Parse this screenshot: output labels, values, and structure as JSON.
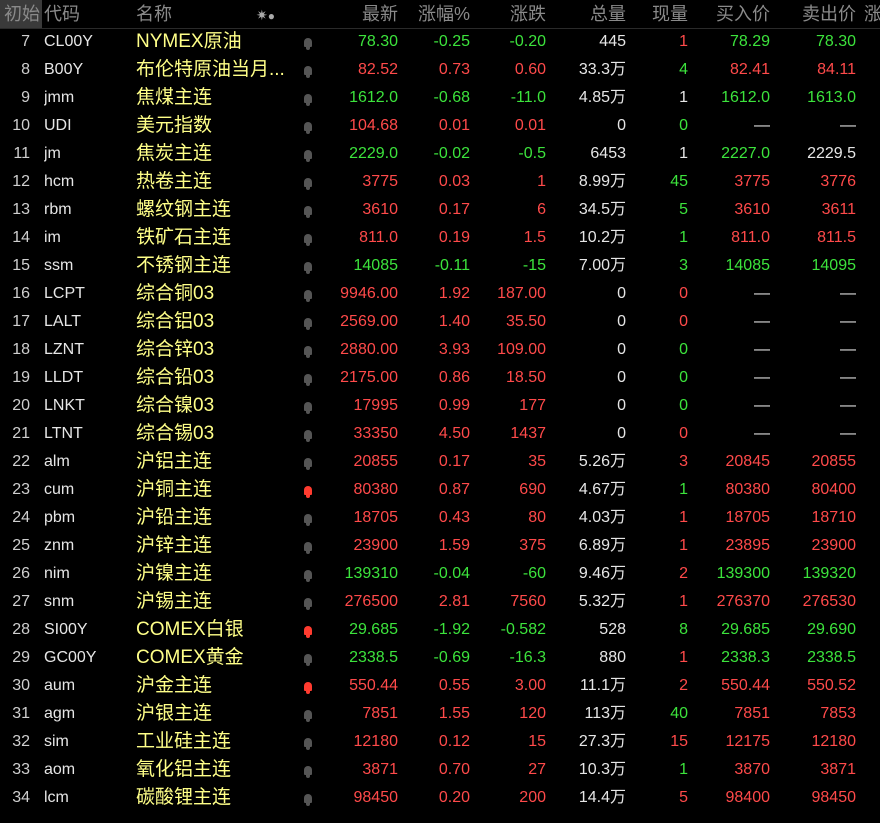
{
  "header": {
    "first": "初始",
    "code": "代码",
    "name": "名称",
    "settings_icon": "settings-icon",
    "last": "最新",
    "pct": "涨幅%",
    "chg": "涨跌",
    "vol": "总量",
    "cur": "现量",
    "bid": "买入价",
    "ask": "卖出价",
    "more": "涨"
  },
  "rows": [
    {
      "num": "7",
      "code": "CL00Y",
      "name": "NYMEX原油",
      "bell": false,
      "last": "78.30",
      "pct": "-0.25",
      "chg": "-0.20",
      "vol": "445",
      "cur": "1",
      "bid": "78.29",
      "ask": "78.30",
      "dir": "down",
      "cur_dir": "up",
      "bid_dir": "down",
      "ask_dir": "down"
    },
    {
      "num": "8",
      "code": "B00Y",
      "name": "布伦特原油当月...",
      "bell": false,
      "last": "82.52",
      "pct": "0.73",
      "chg": "0.60",
      "vol": "33.3万",
      "cur": "4",
      "bid": "82.41",
      "ask": "84.11",
      "dir": "up",
      "cur_dir": "down",
      "bid_dir": "up",
      "ask_dir": "up"
    },
    {
      "num": "9",
      "code": "jmm",
      "name": "焦煤主连",
      "bell": false,
      "last": "1612.0",
      "pct": "-0.68",
      "chg": "-11.0",
      "vol": "4.85万",
      "cur": "1",
      "bid": "1612.0",
      "ask": "1613.0",
      "dir": "down",
      "cur_dir": "flat",
      "bid_dir": "down",
      "ask_dir": "down"
    },
    {
      "num": "10",
      "code": "UDI",
      "name": "美元指数",
      "bell": false,
      "last": "104.68",
      "pct": "0.01",
      "chg": "0.01",
      "vol": "0",
      "cur": "0",
      "bid": "—",
      "ask": "—",
      "dir": "up",
      "cur_dir": "down",
      "bid_dir": "flat",
      "ask_dir": "flat"
    },
    {
      "num": "11",
      "code": "jm",
      "name": "焦炭主连",
      "bell": false,
      "last": "2229.0",
      "pct": "-0.02",
      "chg": "-0.5",
      "vol": "6453",
      "cur": "1",
      "bid": "2227.0",
      "ask": "2229.5",
      "dir": "down",
      "cur_dir": "flat",
      "bid_dir": "down",
      "ask_dir": "flat"
    },
    {
      "num": "12",
      "code": "hcm",
      "name": "热卷主连",
      "bell": false,
      "last": "3775",
      "pct": "0.03",
      "chg": "1",
      "vol": "8.99万",
      "cur": "45",
      "bid": "3775",
      "ask": "3776",
      "dir": "up",
      "cur_dir": "down",
      "bid_dir": "up",
      "ask_dir": "up"
    },
    {
      "num": "13",
      "code": "rbm",
      "name": "螺纹钢主连",
      "bell": false,
      "last": "3610",
      "pct": "0.17",
      "chg": "6",
      "vol": "34.5万",
      "cur": "5",
      "bid": "3610",
      "ask": "3611",
      "dir": "up",
      "cur_dir": "down",
      "bid_dir": "up",
      "ask_dir": "up"
    },
    {
      "num": "14",
      "code": "im",
      "name": "铁矿石主连",
      "bell": false,
      "last": "811.0",
      "pct": "0.19",
      "chg": "1.5",
      "vol": "10.2万",
      "cur": "1",
      "bid": "811.0",
      "ask": "811.5",
      "dir": "up",
      "cur_dir": "down",
      "bid_dir": "up",
      "ask_dir": "up"
    },
    {
      "num": "15",
      "code": "ssm",
      "name": "不锈钢主连",
      "bell": false,
      "last": "14085",
      "pct": "-0.11",
      "chg": "-15",
      "vol": "7.00万",
      "cur": "3",
      "bid": "14085",
      "ask": "14095",
      "dir": "down",
      "cur_dir": "down",
      "bid_dir": "down",
      "ask_dir": "down"
    },
    {
      "num": "16",
      "code": "LCPT",
      "name": "综合铜03",
      "bell": false,
      "last": "9946.00",
      "pct": "1.92",
      "chg": "187.00",
      "vol": "0",
      "cur": "0",
      "bid": "—",
      "ask": "—",
      "dir": "up",
      "cur_dir": "up",
      "bid_dir": "flat",
      "ask_dir": "flat"
    },
    {
      "num": "17",
      "code": "LALT",
      "name": "综合铝03",
      "bell": false,
      "last": "2569.00",
      "pct": "1.40",
      "chg": "35.50",
      "vol": "0",
      "cur": "0",
      "bid": "—",
      "ask": "—",
      "dir": "up",
      "cur_dir": "up",
      "bid_dir": "flat",
      "ask_dir": "flat"
    },
    {
      "num": "18",
      "code": "LZNT",
      "name": "综合锌03",
      "bell": false,
      "last": "2880.00",
      "pct": "3.93",
      "chg": "109.00",
      "vol": "0",
      "cur": "0",
      "bid": "—",
      "ask": "—",
      "dir": "up",
      "cur_dir": "down",
      "bid_dir": "flat",
      "ask_dir": "flat"
    },
    {
      "num": "19",
      "code": "LLDT",
      "name": "综合铅03",
      "bell": false,
      "last": "2175.00",
      "pct": "0.86",
      "chg": "18.50",
      "vol": "0",
      "cur": "0",
      "bid": "—",
      "ask": "—",
      "dir": "up",
      "cur_dir": "down",
      "bid_dir": "flat",
      "ask_dir": "flat"
    },
    {
      "num": "20",
      "code": "LNKT",
      "name": "综合镍03",
      "bell": false,
      "last": "17995",
      "pct": "0.99",
      "chg": "177",
      "vol": "0",
      "cur": "0",
      "bid": "—",
      "ask": "—",
      "dir": "up",
      "cur_dir": "down",
      "bid_dir": "flat",
      "ask_dir": "flat"
    },
    {
      "num": "21",
      "code": "LTNT",
      "name": "综合锡03",
      "bell": false,
      "last": "33350",
      "pct": "4.50",
      "chg": "1437",
      "vol": "0",
      "cur": "0",
      "bid": "—",
      "ask": "—",
      "dir": "up",
      "cur_dir": "up",
      "bid_dir": "flat",
      "ask_dir": "flat"
    },
    {
      "num": "22",
      "code": "alm",
      "name": "沪铝主连",
      "bell": false,
      "last": "20855",
      "pct": "0.17",
      "chg": "35",
      "vol": "5.26万",
      "cur": "3",
      "bid": "20845",
      "ask": "20855",
      "dir": "up",
      "cur_dir": "up",
      "bid_dir": "up",
      "ask_dir": "up"
    },
    {
      "num": "23",
      "code": "cum",
      "name": "沪铜主连",
      "bell": true,
      "last": "80380",
      "pct": "0.87",
      "chg": "690",
      "vol": "4.67万",
      "cur": "1",
      "bid": "80380",
      "ask": "80400",
      "dir": "up",
      "cur_dir": "down",
      "bid_dir": "up",
      "ask_dir": "up"
    },
    {
      "num": "24",
      "code": "pbm",
      "name": "沪铅主连",
      "bell": false,
      "last": "18705",
      "pct": "0.43",
      "chg": "80",
      "vol": "4.03万",
      "cur": "1",
      "bid": "18705",
      "ask": "18710",
      "dir": "up",
      "cur_dir": "up",
      "bid_dir": "up",
      "ask_dir": "up"
    },
    {
      "num": "25",
      "code": "znm",
      "name": "沪锌主连",
      "bell": false,
      "last": "23900",
      "pct": "1.59",
      "chg": "375",
      "vol": "6.89万",
      "cur": "1",
      "bid": "23895",
      "ask": "23900",
      "dir": "up",
      "cur_dir": "up",
      "bid_dir": "up",
      "ask_dir": "up"
    },
    {
      "num": "26",
      "code": "nim",
      "name": "沪镍主连",
      "bell": false,
      "last": "139310",
      "pct": "-0.04",
      "chg": "-60",
      "vol": "9.46万",
      "cur": "2",
      "bid": "139300",
      "ask": "139320",
      "dir": "down",
      "cur_dir": "up",
      "bid_dir": "down",
      "ask_dir": "down"
    },
    {
      "num": "27",
      "code": "snm",
      "name": "沪锡主连",
      "bell": false,
      "last": "276500",
      "pct": "2.81",
      "chg": "7560",
      "vol": "5.32万",
      "cur": "1",
      "bid": "276370",
      "ask": "276530",
      "dir": "up",
      "cur_dir": "up",
      "bid_dir": "up",
      "ask_dir": "up"
    },
    {
      "num": "28",
      "code": "SI00Y",
      "name": "COMEX白银",
      "bell": true,
      "last": "29.685",
      "pct": "-1.92",
      "chg": "-0.582",
      "vol": "528",
      "cur": "8",
      "bid": "29.685",
      "ask": "29.690",
      "dir": "down",
      "cur_dir": "down",
      "bid_dir": "down",
      "ask_dir": "down"
    },
    {
      "num": "29",
      "code": "GC00Y",
      "name": "COMEX黄金",
      "bell": false,
      "last": "2338.5",
      "pct": "-0.69",
      "chg": "-16.3",
      "vol": "880",
      "cur": "1",
      "bid": "2338.3",
      "ask": "2338.5",
      "dir": "down",
      "cur_dir": "up",
      "bid_dir": "down",
      "ask_dir": "down"
    },
    {
      "num": "30",
      "code": "aum",
      "name": "沪金主连",
      "bell": true,
      "last": "550.44",
      "pct": "0.55",
      "chg": "3.00",
      "vol": "11.1万",
      "cur": "2",
      "bid": "550.44",
      "ask": "550.52",
      "dir": "up",
      "cur_dir": "up",
      "bid_dir": "up",
      "ask_dir": "up"
    },
    {
      "num": "31",
      "code": "agm",
      "name": "沪银主连",
      "bell": false,
      "last": "7851",
      "pct": "1.55",
      "chg": "120",
      "vol": "113万",
      "cur": "40",
      "bid": "7851",
      "ask": "7853",
      "dir": "up",
      "cur_dir": "down",
      "bid_dir": "up",
      "ask_dir": "up"
    },
    {
      "num": "32",
      "code": "sim",
      "name": "工业硅主连",
      "bell": false,
      "last": "12180",
      "pct": "0.12",
      "chg": "15",
      "vol": "27.3万",
      "cur": "15",
      "bid": "12175",
      "ask": "12180",
      "dir": "up",
      "cur_dir": "up",
      "bid_dir": "up",
      "ask_dir": "up"
    },
    {
      "num": "33",
      "code": "aom",
      "name": "氧化铝主连",
      "bell": false,
      "last": "3871",
      "pct": "0.70",
      "chg": "27",
      "vol": "10.3万",
      "cur": "1",
      "bid": "3870",
      "ask": "3871",
      "dir": "up",
      "cur_dir": "down",
      "bid_dir": "up",
      "ask_dir": "up"
    },
    {
      "num": "34",
      "code": "lcm",
      "name": "碳酸锂主连",
      "bell": false,
      "last": "98450",
      "pct": "0.20",
      "chg": "200",
      "vol": "14.4万",
      "cur": "5",
      "bid": "98400",
      "ask": "98450",
      "dir": "up",
      "cur_dir": "up",
      "bid_dir": "up",
      "ask_dir": "up"
    }
  ],
  "colors": {
    "up": "#ff4a4a",
    "down": "#3ce33c",
    "name": "#ffff88",
    "bell_active": "#ff3b2f"
  }
}
